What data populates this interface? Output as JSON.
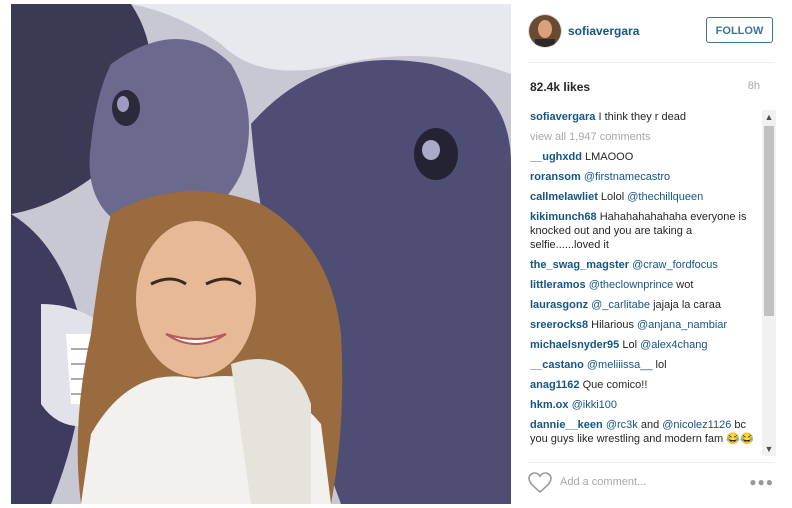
{
  "post": {
    "username": "sofiavergara",
    "follow_label": "FOLLOW",
    "likes": "82.4k likes",
    "time": "8h",
    "caption_user": "sofiavergara",
    "caption_text": " I think they r dead",
    "view_all": "view all 1,947 comments",
    "add_comment_placeholder": "Add a comment...",
    "more_icon": "ellipsis-icon",
    "heart_icon": "heart-icon"
  },
  "comments": [
    {
      "user": "__ughxdd",
      "text": " LMAOOO",
      "mention": ""
    },
    {
      "user": "roransom",
      "text": " ",
      "mention": "@firstnamecastro"
    },
    {
      "user": "callmelawliet",
      "text": " Lolol ",
      "mention": "@thechillqueen"
    },
    {
      "user": "kikimunch68",
      "text": " Hahahahahahaha everyone is knocked out and you are taking a selfie......loved it",
      "mention": ""
    },
    {
      "user": "the_swag_magster",
      "text": " ",
      "mention": "@craw_fordfocus"
    },
    {
      "user": "littleramos",
      "text": " ",
      "mention": "@theclownprince",
      "after": " wot"
    },
    {
      "user": "laurasgonz",
      "text": " ",
      "mention": "@_carlitabe",
      "after": " jajaja la caraa"
    },
    {
      "user": "sreerocks8",
      "text": " Hilarious ",
      "mention": "@anjana_nambiar"
    },
    {
      "user": "michaelsnyder95",
      "text": " Lol ",
      "mention": "@alex4chang"
    },
    {
      "user": "__castano",
      "text": " ",
      "mention": "@meliiissa__",
      "after": " lol"
    },
    {
      "user": "anag1162",
      "text": " Que comico!!",
      "mention": ""
    },
    {
      "user": "hkm.ox",
      "text": " ",
      "mention": "@ikki100"
    },
    {
      "user": "dannie__keen",
      "text": " ",
      "mention": "@rc3k",
      "after": " and ",
      "mention2": "@nicolez1126",
      "after2": " bc you guys like wrestling and modern fam 😂😂"
    }
  ],
  "colors": {
    "link": "#125688",
    "follow_border": "#3f729b",
    "muted": "#a5a7aa"
  }
}
